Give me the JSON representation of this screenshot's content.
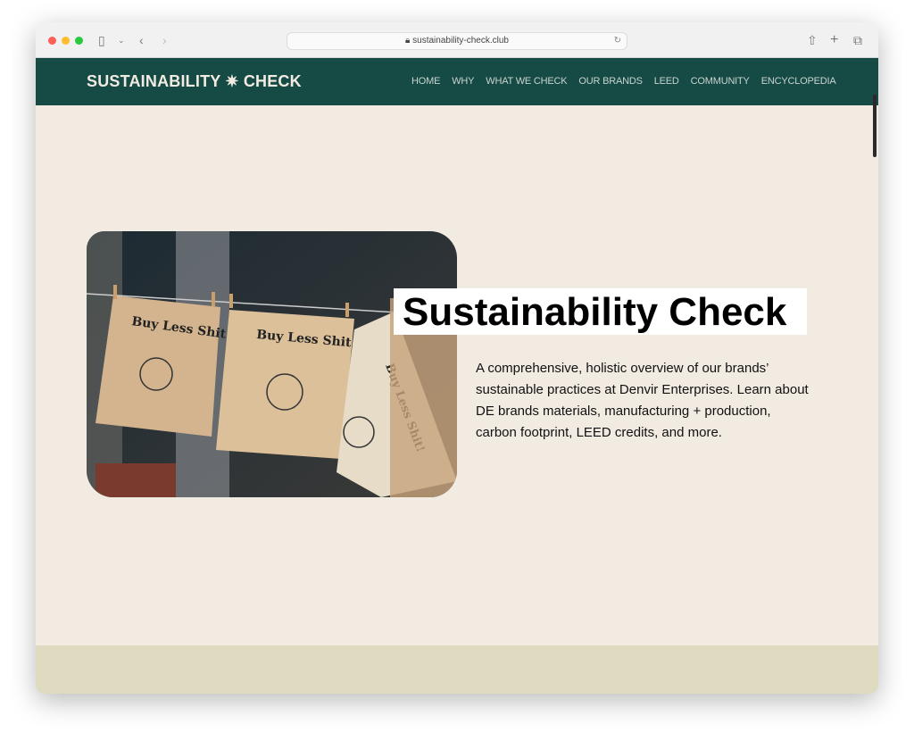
{
  "browser": {
    "url": "sustainability-check.club",
    "traffic_lights": [
      "#fe5f57",
      "#febc2e",
      "#28c840"
    ]
  },
  "nav": {
    "logo": "SUSTAINABILITY ✷ CHECK",
    "items": [
      "HOME",
      "WHY",
      "WHAT WE CHECK",
      "OUR BRANDS",
      "LEED",
      "COMMUNITY",
      "ENCYCLOPEDIA"
    ]
  },
  "hero": {
    "title": "Sustainability Check",
    "description": "A comprehensive, holistic overview of our brands’ sustainable practices at Denvir Enterprises. Learn about DE brands materials, manufacturing + production, carbon footprint, LEED credits, and more.",
    "photo_lettering": [
      "Buy Less Shit!",
      "Buy Less Shit!",
      "Buy Less Shit!"
    ]
  },
  "colors": {
    "nav": "#164b45",
    "background": "#f2ebe2",
    "footer": "#dedbc0"
  }
}
